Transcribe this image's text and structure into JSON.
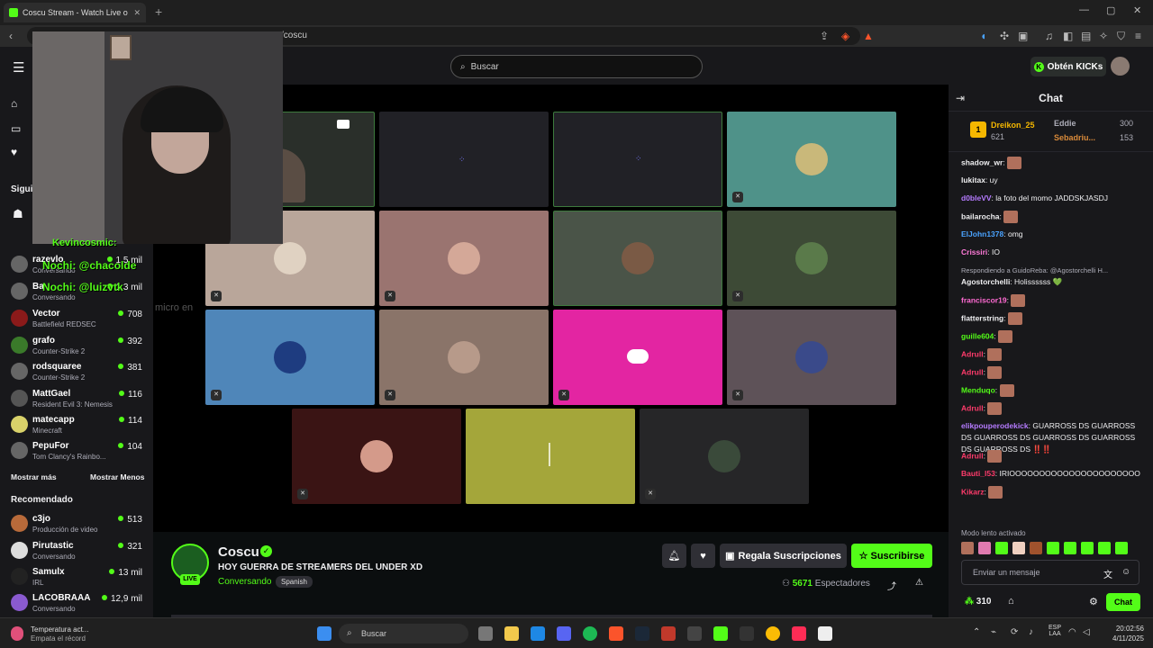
{
  "browser": {
    "tab_title": "Coscu Stream - Watch Live o",
    "url": "/coscu"
  },
  "header": {
    "search_placeholder": "Buscar",
    "kicks_label": "Obtén KICKs"
  },
  "sidebar": {
    "following_label": "Sigui",
    "channels": [
      {
        "name": "razevlo",
        "category": "Conversando",
        "viewers": "1,5 mil"
      },
      {
        "name": "Ba",
        "category": "Conversando",
        "viewers": "1,3 mil"
      },
      {
        "name": "Vector",
        "category": "Battlefield REDSEC",
        "viewers": "708"
      },
      {
        "name": "grafo",
        "category": "Counter-Strike 2",
        "viewers": "392"
      },
      {
        "name": "rodsquaree",
        "category": "Counter-Strike 2",
        "viewers": "381"
      },
      {
        "name": "MattGael",
        "category": "Resident Evil 3: Nemesis",
        "viewers": "116"
      },
      {
        "name": "matecapp",
        "category": "Minecraft",
        "viewers": "114"
      },
      {
        "name": "PepuFor",
        "category": "Tom Clancy's Rainbo...",
        "viewers": "104"
      }
    ],
    "show_more": "Mostrar más",
    "show_less": "Mostrar Menos",
    "recommended_label": "Recomendado",
    "recommended": [
      {
        "name": "c3jo",
        "category": "Producción de video",
        "viewers": "513"
      },
      {
        "name": "Pirutastic",
        "category": "Conversando",
        "viewers": "321"
      },
      {
        "name": "Samulx",
        "category": "IRL",
        "viewers": "13 mil"
      },
      {
        "name": "LACOBRAAA",
        "category": "Conversando",
        "viewers": "12,9 mil"
      }
    ]
  },
  "overlay": {
    "line1": "Kevincosmic:",
    "line2": "Nochi: @chacolde",
    "line3": "Nochi: @luizvtk",
    "line4": "micro en"
  },
  "stream": {
    "channel": "Coscu",
    "live": "LIVE",
    "title": "HOY GUERRA DE STREAMERS DEL UNDER XD",
    "category": "Conversando",
    "language": "Spanish",
    "gift_label": "Regala Suscripciones",
    "subscribe_label": "Suscribirse",
    "viewers": "5671",
    "viewers_label": "Espectadores"
  },
  "chat": {
    "title": "Chat",
    "leaderboard": [
      {
        "rank": "1",
        "name": "Dreikon_25",
        "value": "621"
      },
      {
        "name": "Eddie",
        "value": "300"
      },
      {
        "name": "Sebadriu...",
        "value": "153"
      }
    ],
    "messages": [
      {
        "user": "shadow_wr",
        "text": "",
        "color": "#efeff1"
      },
      {
        "user": "lukitax",
        "text": "uy",
        "color": "#efeff1"
      },
      {
        "user": "d0bleVV",
        "text": "la foto del momo JADDSKJASDJ",
        "color": "#b57bff"
      },
      {
        "user": "bailarocha",
        "text": "",
        "color": "#efeff1"
      },
      {
        "user": "ElJohn1378",
        "text": "omg",
        "color": "#4aa3ff"
      },
      {
        "user": "Crissiri",
        "text": "IO",
        "color": "#ff7ad9"
      },
      {
        "user": "Agostorchelli",
        "text": "Holissssss 💚",
        "color": "#efeff1",
        "reply": "Respondiendo a GuidoReba: @Agostorchelli H..."
      },
      {
        "user": "franciscor19",
        "text": "",
        "color": "#ff6bd3"
      },
      {
        "user": "flatterstring",
        "text": "",
        "color": "#efeff1"
      },
      {
        "user": "guille604",
        "text": "",
        "color": "#53fc18"
      },
      {
        "user": "Adrull",
        "text": "",
        "color": "#ff3b6b"
      },
      {
        "user": "Adrull",
        "text": "",
        "color": "#ff3b6b"
      },
      {
        "user": "Menduqo",
        "text": "",
        "color": "#53fc18"
      },
      {
        "user": "Adrull",
        "text": "",
        "color": "#ff3b6b"
      },
      {
        "user": "elikpouperodekick",
        "text": "GUARROSS DS GUARROSS DS GUARROSS DS GUARROSS DS GUARROSS DS GUARROSS DS ‼️‼️",
        "color": "#b57bff"
      },
      {
        "user": "Adrull",
        "text": "",
        "color": "#ff3b6b"
      },
      {
        "user": "Bauti_l53",
        "text": "IRIOOOOOOOOOOOOOOOOOOOOOO",
        "color": "#ff3b6b"
      },
      {
        "user": "Kikarz",
        "text": "",
        "color": "#ff3b6b"
      }
    ],
    "slow_mode": "Modo lento activado",
    "input_placeholder": "Enviar un mensaje",
    "points": "310",
    "send_label": "Chat"
  },
  "taskbar": {
    "weather_title": "Temperatura act...",
    "weather_sub": "Empata el récord",
    "search": "Buscar",
    "lang": "ESP",
    "lang2": "LAA",
    "time": "20:02:56",
    "date": "4/11/2025"
  },
  "colors": {
    "accent": "#53fc18",
    "bg": "#0b0e0f",
    "panel": "#18181b"
  }
}
